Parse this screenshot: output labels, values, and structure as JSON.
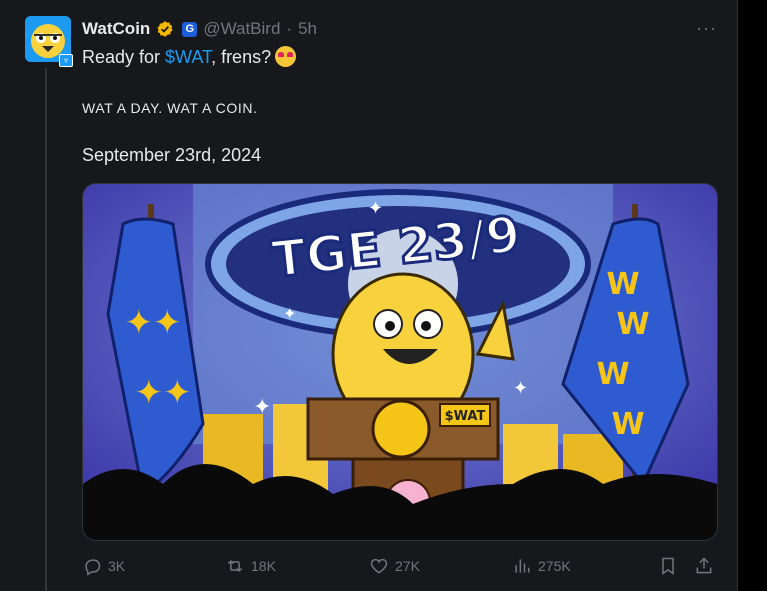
{
  "tweet": {
    "display_name": "WatCoin",
    "handle": "@WatBird",
    "separator": "·",
    "time": "5h",
    "badge_letter": "G",
    "text_prefix": "Ready for ",
    "cashtag": "$WAT",
    "text_suffix": ", frens?",
    "subline": "WAT A DAY. WAT A COIN.",
    "date_line": "September 23rd, 2024",
    "more_label": "···"
  },
  "media": {
    "banner_text": "TGE 23/9",
    "sign_text": "$WAT",
    "flag_letter": "W"
  },
  "metrics": {
    "replies": "3K",
    "reposts": "18K",
    "likes": "27K",
    "views": "275K"
  },
  "colors": {
    "accent": "#1d9bf0",
    "background": "#16181c",
    "verified": "#f5b800"
  },
  "icons": [
    "verified-icon",
    "reply-icon",
    "repost-icon",
    "like-icon",
    "views-icon",
    "bookmark-icon",
    "share-icon",
    "more-icon"
  ]
}
